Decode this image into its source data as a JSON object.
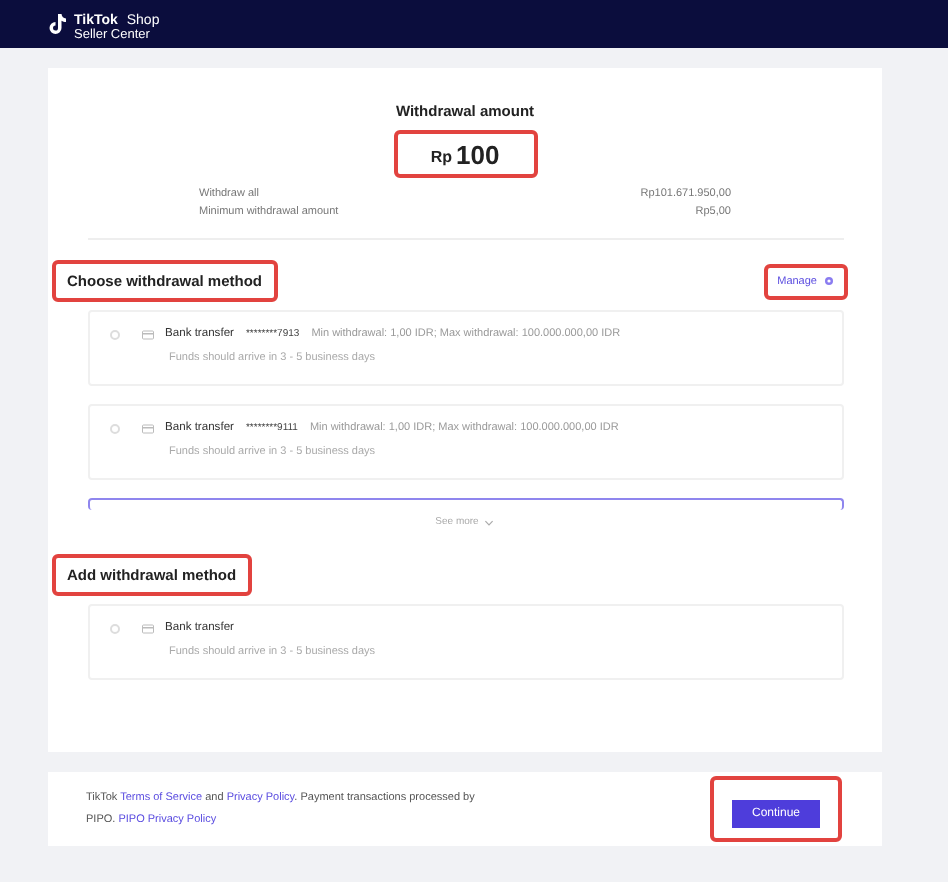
{
  "header": {
    "brand": "TikTok",
    "product": "Shop",
    "subtitle": "Seller Center"
  },
  "amount": {
    "title": "Withdrawal amount",
    "currency": "Rp",
    "value": "100",
    "highlighted": true
  },
  "summary": [
    {
      "label": "Withdraw all",
      "value": "Rp101.671.950,00"
    },
    {
      "label": "Minimum withdrawal amount",
      "value": "Rp5,00"
    }
  ],
  "choose_section": {
    "title": "Choose withdrawal method",
    "highlighted": true,
    "manage_link": "Manage",
    "manage_highlighted": true
  },
  "methods": [
    {
      "name": "Bank transfer",
      "account": "********7913",
      "limits": "Min withdrawal: 1,00 IDR; Max withdrawal: 100.000.000,00 IDR",
      "note": "Funds should arrive in 3 - 5 business days",
      "selected": false
    },
    {
      "name": "Bank transfer",
      "account": "********9111",
      "limits": "Min withdrawal: 1,00 IDR; Max withdrawal: 100.000.000,00 IDR",
      "note": "Funds should arrive in 3 - 5 business days",
      "selected": false
    },
    {
      "selected": true
    }
  ],
  "see_more": "See more",
  "add_section": {
    "title": "Add withdrawal method",
    "highlighted": true
  },
  "add_methods": [
    {
      "name": "Bank transfer",
      "note": "Funds should arrive in 3 - 5 business days",
      "selected": false
    }
  ],
  "footer": {
    "legal": [
      {
        "kind": "text",
        "text": "TikTok "
      },
      {
        "kind": "link",
        "text": "Terms of Service"
      },
      {
        "kind": "text",
        "text": " and "
      },
      {
        "kind": "link",
        "text": "Privacy Policy"
      },
      {
        "kind": "text",
        "text": ". Payment transactions processed by PIPO. "
      },
      {
        "kind": "link",
        "text": "PIPO Privacy Policy"
      }
    ],
    "continue_button": {
      "label": "Continue",
      "highlighted": true
    }
  }
}
